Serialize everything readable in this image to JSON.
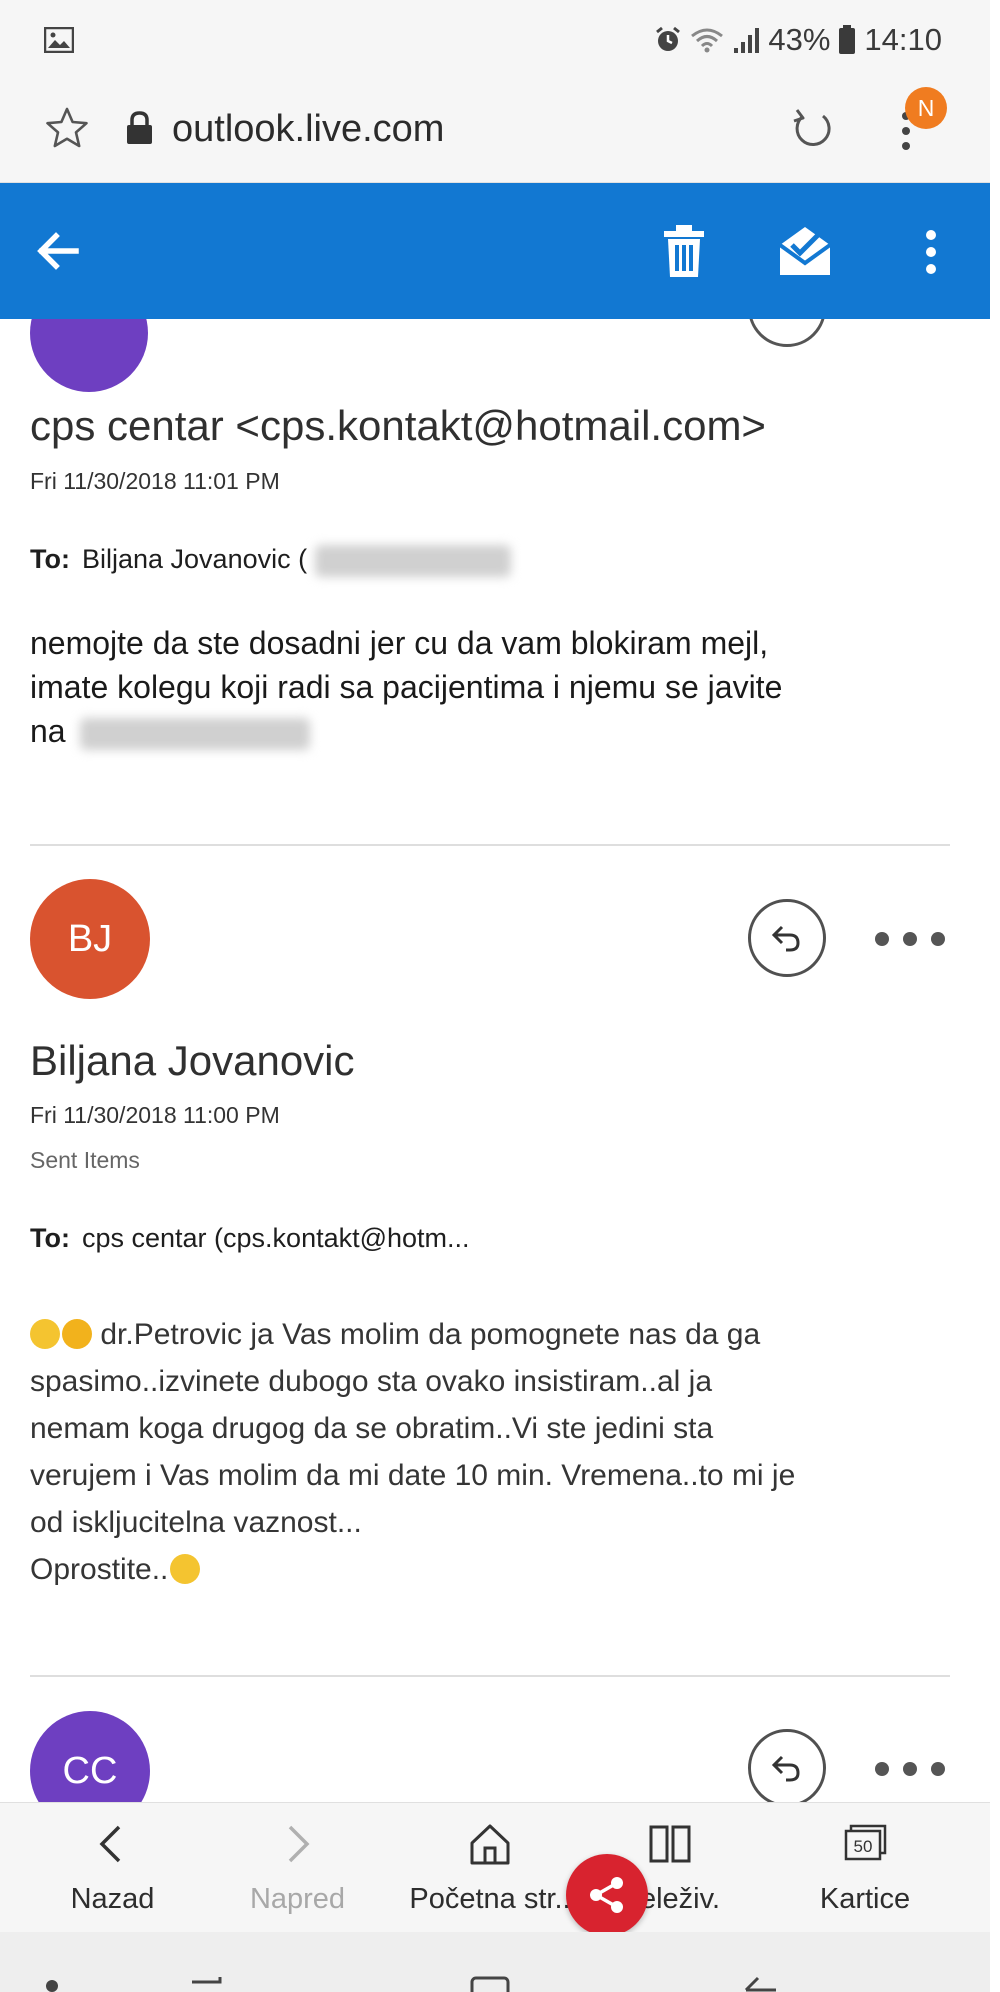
{
  "status_bar": {
    "battery": "43%",
    "time": "14:10",
    "icons": [
      "image-icon",
      "alarm-icon",
      "wifi-icon",
      "signal-icon",
      "battery-icon"
    ]
  },
  "browser": {
    "url": "outlook.live.com",
    "notification_badge": "N",
    "icons": [
      "star-icon",
      "lock-icon",
      "reload-icon",
      "menu-icon"
    ]
  },
  "app_bar": {
    "color": "#1278d2",
    "icons": [
      "back-arrow-icon",
      "trash-icon",
      "mark-read-icon",
      "more-vertical-icon"
    ]
  },
  "messages": [
    {
      "sender": "cps centar <cps.kontakt@hotmail.com>",
      "date": "Fri 11/30/2018 11:01 PM",
      "to_label": "To:",
      "to_value": "Biljana Jovanovic (",
      "body_lines": [
        "nemojte da ste dosadni jer cu da vam blokiram mejl,",
        "imate kolegu koji radi sa pacijentima i njemu se javite",
        "na"
      ]
    },
    {
      "avatar_initials": "BJ",
      "avatar_color": "#d9532f",
      "sender": "Biljana Jovanovic",
      "date": "Fri 11/30/2018 11:00 PM",
      "folder": "Sent Items",
      "to_label": "To:",
      "to_value": "cps centar (cps.kontakt@hotm...",
      "body_lines": [
        " dr.Petrovic ja Vas molim da pomognete nas da ga",
        "spasimo..izvinete dubogo sta ovako insistiram..al ja",
        "nemam koga drugog da se obratim..Vi ste jedini sta",
        "verujem i Vas molim da mi date 10 min. Vremena..to mi je",
        "od iskljucitelna vaznost...",
        "Oprostite.."
      ]
    },
    {
      "avatar_initials": "CC",
      "avatar_color": "#6e3fc1"
    }
  ],
  "bottom_nav": {
    "items": [
      {
        "label": "Nazad",
        "icon": "chevron-left-icon",
        "enabled": true
      },
      {
        "label": "Napred",
        "icon": "chevron-right-icon",
        "enabled": false
      },
      {
        "label": "Početna str..",
        "icon": "home-icon",
        "enabled": true
      },
      {
        "label": "eleživ.",
        "icon": "bookmarks-icon",
        "enabled": true
      },
      {
        "label": "Kartice",
        "icon": "tabs-icon",
        "enabled": true
      }
    ],
    "tabs_count": "50",
    "share_color": "#d8232f"
  }
}
